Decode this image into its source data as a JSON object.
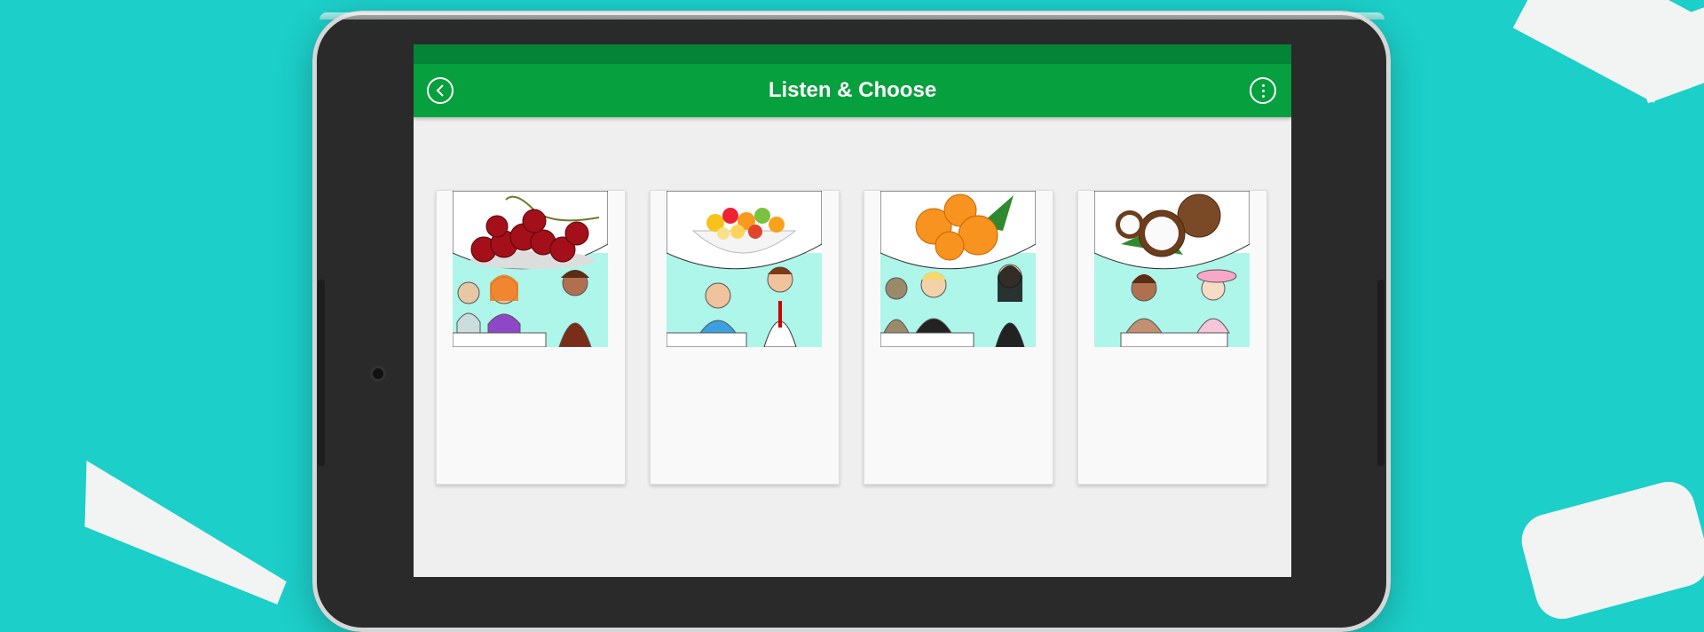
{
  "app": {
    "title": "Listen & Choose",
    "accent": "#07a03e",
    "statusbar_color": "#048437",
    "background": "#1ccfc9"
  },
  "icons": {
    "back": "back-arrow-circle-icon",
    "menu": "more-vertical-circle-icon"
  },
  "cards": [
    {
      "food": "cherries",
      "speaker": "woman-orange-hair",
      "food_color": "#a3101a"
    },
    {
      "food": "fruit-salad",
      "speaker": "bald-man",
      "food_color": "#f6a31b"
    },
    {
      "food": "oranges",
      "speaker": "blond-man",
      "food_color": "#f7931e"
    },
    {
      "food": "coconut",
      "speaker": "curly-woman",
      "food_color": "#7a4a26"
    }
  ]
}
